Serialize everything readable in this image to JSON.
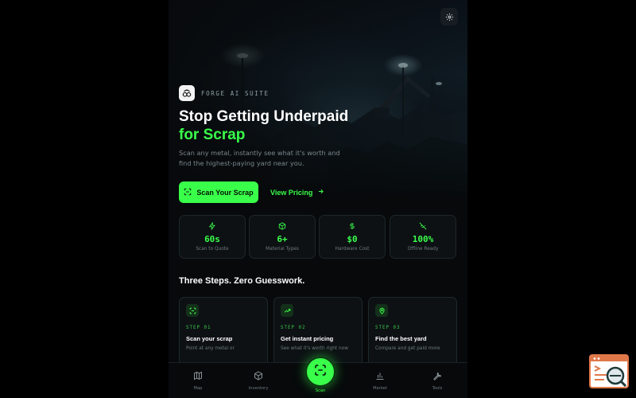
{
  "brand": {
    "name": "FORGE AI SUITE"
  },
  "hero": {
    "headline_line1": "Stop Getting Underpaid",
    "headline_line2": "for Scrap",
    "subtitle": "Scan any metal, instantly see what it's worth and find the highest-paying yard near you.",
    "primary_button": "Scan Your Scrap",
    "secondary_button": "View Pricing"
  },
  "stats": [
    {
      "icon": "bolt-icon",
      "value": "60s",
      "label": "Scan to Quote"
    },
    {
      "icon": "box-icon",
      "value": "6+",
      "label": "Material Types"
    },
    {
      "icon": "dollar-icon",
      "value": "$0",
      "label": "Hardware Cost"
    },
    {
      "icon": "wifi-off-icon",
      "value": "100%",
      "label": "Offline Ready"
    }
  ],
  "steps_section": {
    "title": "Three Steps. Zero Guesswork.",
    "steps": [
      {
        "icon": "scan-icon",
        "label": "STEP 01",
        "title": "Scan your scrap",
        "desc": "Point at any metal or"
      },
      {
        "icon": "trend-up-icon",
        "label": "STEP 02",
        "title": "Get instant pricing",
        "desc": "See what it's worth right now"
      },
      {
        "icon": "map-pin-icon",
        "label": "STEP 03",
        "title": "Find the best yard",
        "desc": "Compare and get paid more"
      }
    ]
  },
  "bottom_nav": {
    "items": [
      {
        "icon": "map-icon",
        "label": "Map"
      },
      {
        "icon": "cube-icon",
        "label": "Inventory"
      },
      {
        "icon": "scan-icon",
        "label": "Scan"
      },
      {
        "icon": "bar-chart-icon",
        "label": "Market"
      },
      {
        "icon": "wrench-icon",
        "label": "Tools"
      }
    ]
  },
  "colors": {
    "accent": "#39ff4a",
    "background": "#07090b",
    "card": "#0d1114",
    "muted_text": "#6f7a7e"
  }
}
